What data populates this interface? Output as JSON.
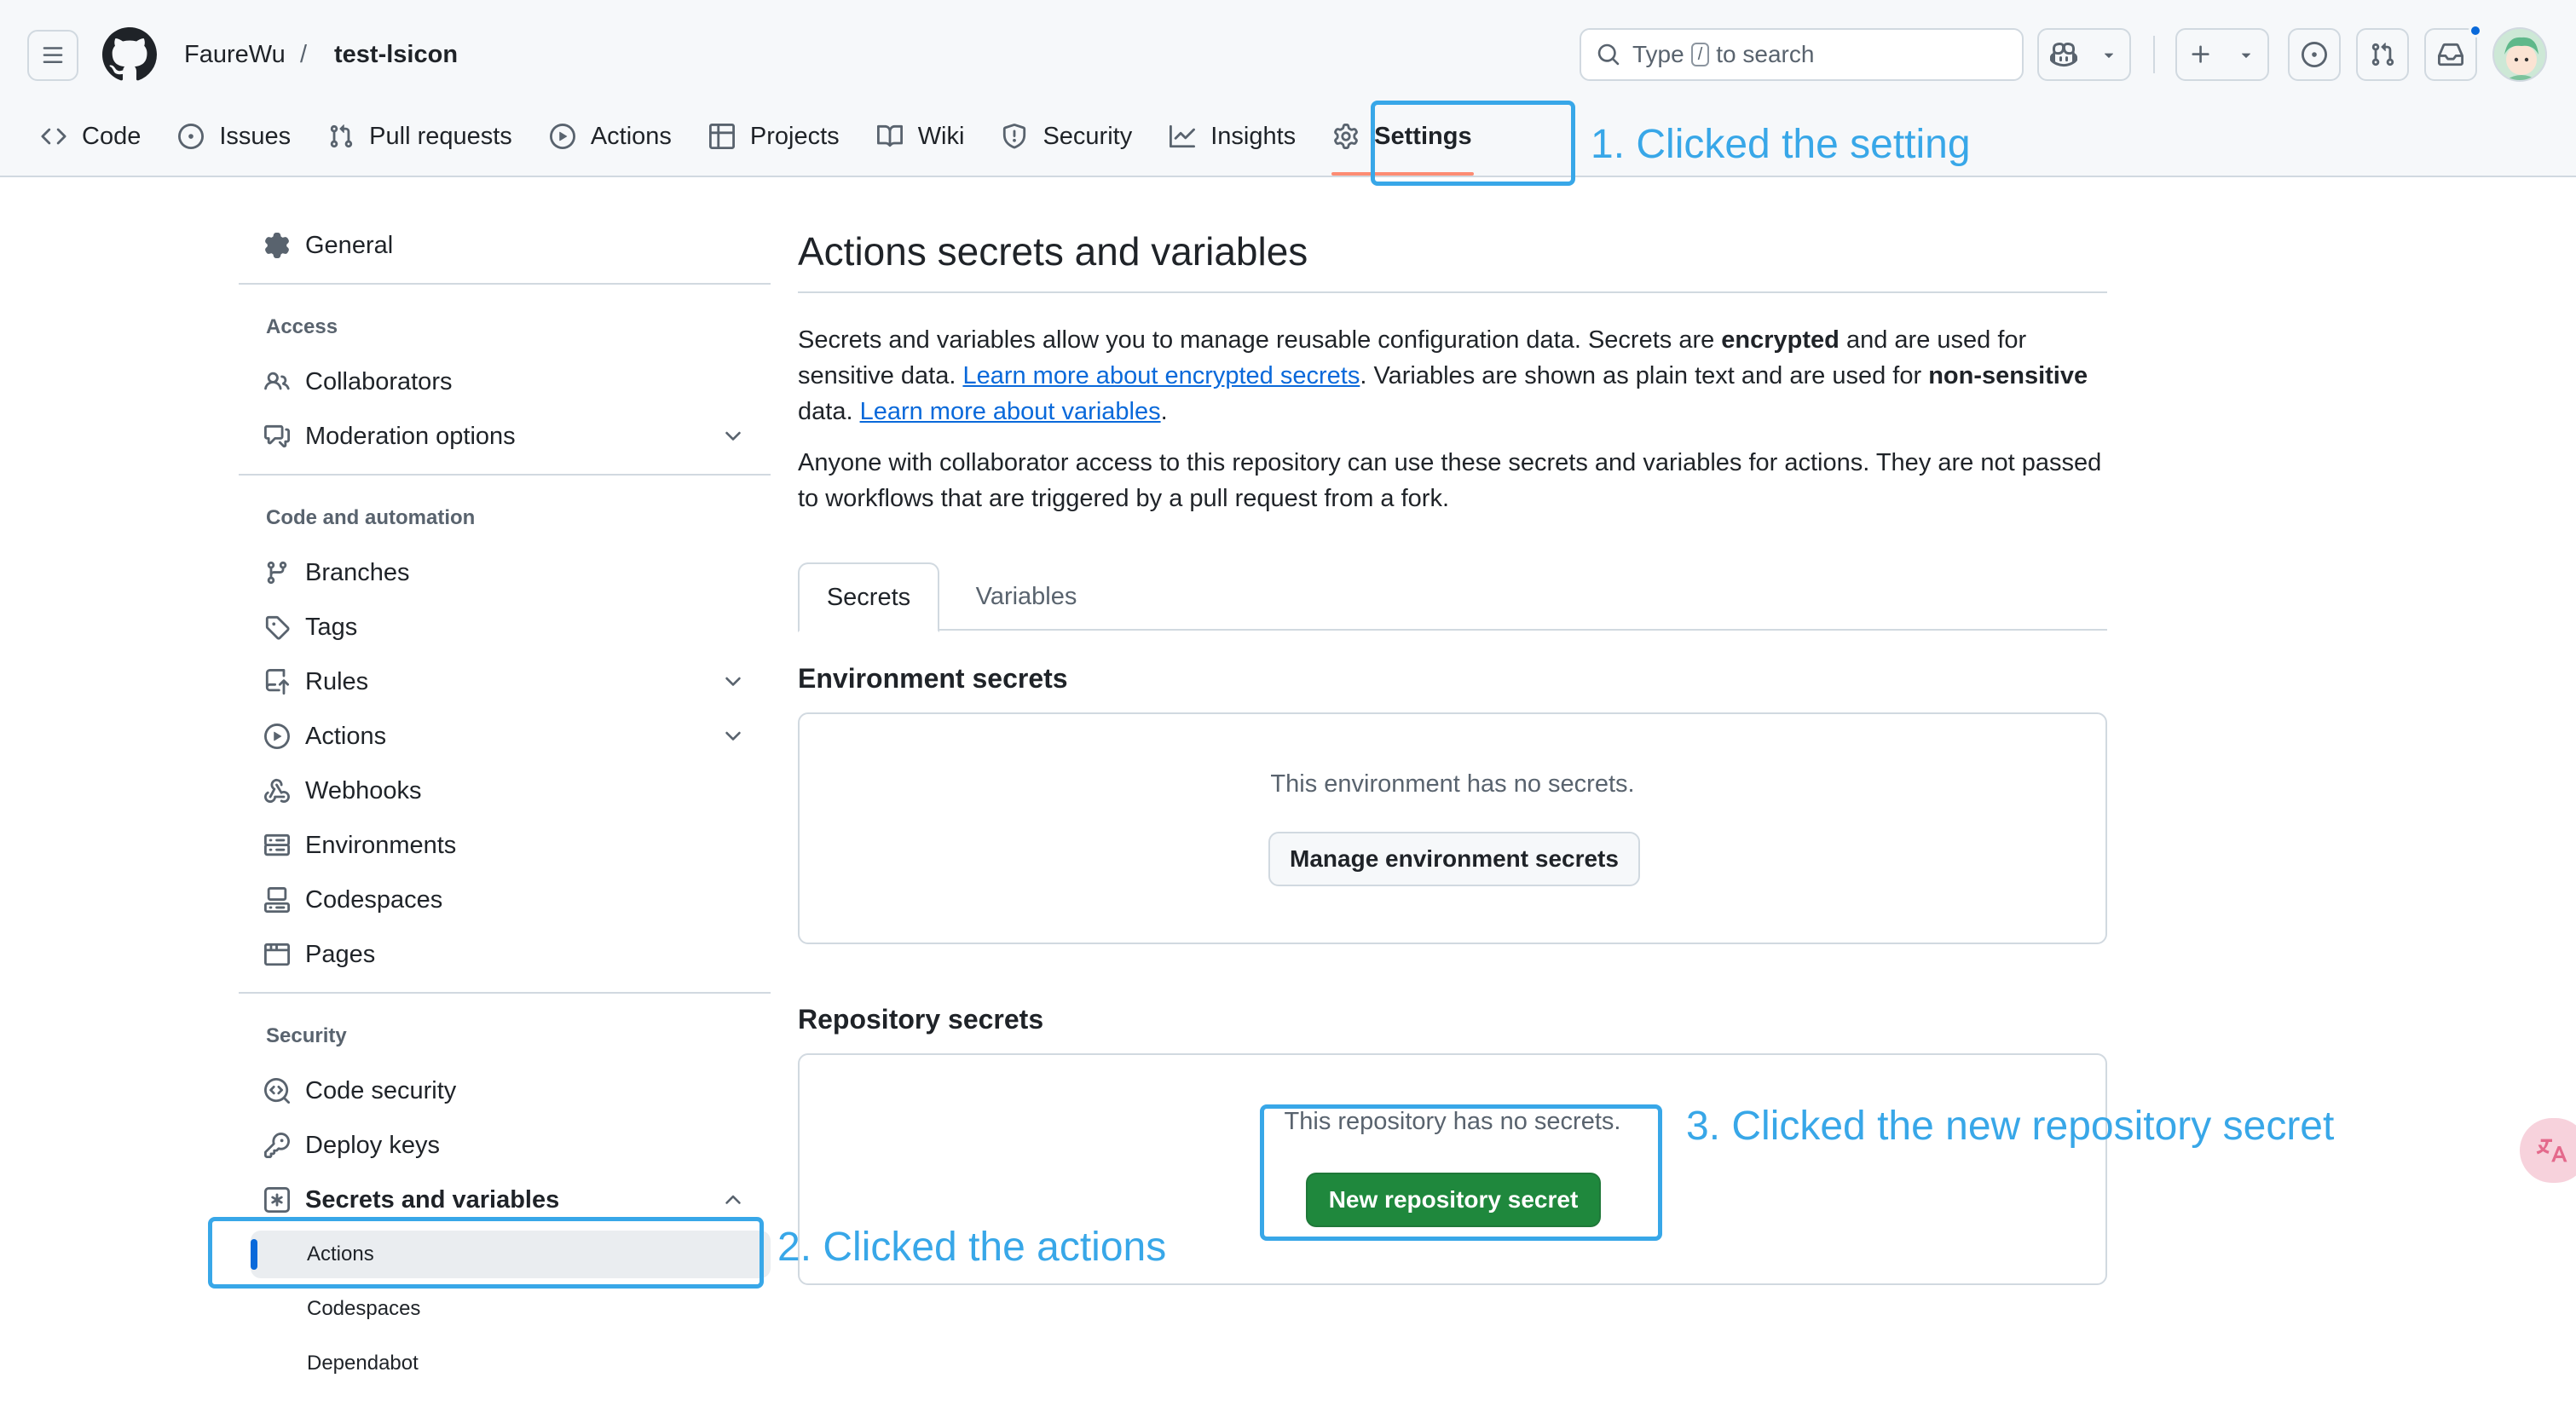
{
  "header": {
    "owner": "FaureWu",
    "separator": "/",
    "repo": "test-lsicon",
    "search": {
      "prefix": "Type",
      "key": "/",
      "suffix": "to search"
    }
  },
  "repo_nav": {
    "tabs": [
      {
        "label": "Code",
        "icon": "code-icon"
      },
      {
        "label": "Issues",
        "icon": "issue-opened-icon"
      },
      {
        "label": "Pull requests",
        "icon": "git-pull-request-icon"
      },
      {
        "label": "Actions",
        "icon": "play-icon"
      },
      {
        "label": "Projects",
        "icon": "table-icon"
      },
      {
        "label": "Wiki",
        "icon": "book-icon"
      },
      {
        "label": "Security",
        "icon": "shield-icon"
      },
      {
        "label": "Insights",
        "icon": "graph-icon"
      },
      {
        "label": "Settings",
        "icon": "gear-icon",
        "selected": true
      }
    ]
  },
  "sidebar": {
    "general": "General",
    "access_heading": "Access",
    "collaborators": "Collaborators",
    "moderation": "Moderation options",
    "code_heading": "Code and automation",
    "branches": "Branches",
    "tags": "Tags",
    "rules": "Rules",
    "actions": "Actions",
    "webhooks": "Webhooks",
    "environments": "Environments",
    "codespaces": "Codespaces",
    "pages": "Pages",
    "security_heading": "Security",
    "code_security": "Code security",
    "deploy_keys": "Deploy keys",
    "secrets_vars": "Secrets and variables",
    "sub_actions": "Actions",
    "sub_codespaces": "Codespaces",
    "sub_dependabot": "Dependabot"
  },
  "main": {
    "title": "Actions secrets and variables",
    "intro": {
      "p1_a": "Secrets and variables allow you to manage reusable configuration data. Secrets are ",
      "p1_b": "encrypted",
      "p1_c": " and are used for sensitive data. ",
      "p1_link1": "Learn more about encrypted secrets",
      "p1_d": ". Variables are shown as plain text and are used for ",
      "p1_e": "non-sensitive",
      "p1_f": " data. ",
      "p1_link2": "Learn more about variables",
      "p1_g": ".",
      "p2": "Anyone with collaborator access to this repository can use these secrets and variables for actions. They are not passed to workflows that are triggered by a pull request from a fork."
    },
    "tabs": {
      "secrets": "Secrets",
      "variables": "Variables"
    },
    "env_section": {
      "title": "Environment secrets",
      "empty": "This environment has no secrets.",
      "button": "Manage environment secrets"
    },
    "repo_section": {
      "title": "Repository secrets",
      "empty": "This repository has no secrets.",
      "button": "New repository secret"
    }
  },
  "annotations": {
    "step1": "1. Clicked the setting",
    "step2": "2. Clicked the actions",
    "step3": "3. Clicked the new repository secret"
  },
  "colors": {
    "annotation": "#38a7e8",
    "primary_button": "#1f883d",
    "link": "#0969da",
    "selected_tab_underline": "#fd8c73"
  }
}
